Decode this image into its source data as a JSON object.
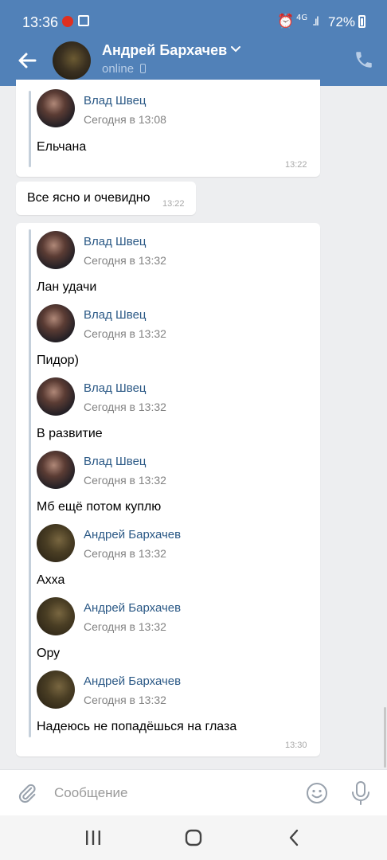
{
  "status_bar": {
    "time": "13:36",
    "network": "4G",
    "battery": "72%"
  },
  "header": {
    "name": "Андрей Бархачев",
    "status": "online"
  },
  "messages": [
    {
      "forwarded": [
        {
          "author": "Влад Швец",
          "date": "Сегодня в 13:08",
          "text": "Ельчана"
        }
      ],
      "time": "13:22"
    },
    {
      "text": "Все ясно и очевидно",
      "time": "13:22"
    },
    {
      "forwarded": [
        {
          "author": "Влад Швец",
          "date": "Сегодня в 13:32",
          "text": "Лан удачи"
        },
        {
          "author": "Влад Швец",
          "date": "Сегодня в 13:32",
          "text": "Пидор)"
        },
        {
          "author": "Влад Швец",
          "date": "Сегодня в 13:32",
          "text": "В развитие"
        },
        {
          "author": "Влад Швец",
          "date": "Сегодня в 13:32",
          "text": "Мб ещё потом куплю"
        },
        {
          "author": "Андрей Бархачев",
          "date": "Сегодня в 13:32",
          "text": "Ахха"
        },
        {
          "author": "Андрей Бархачев",
          "date": "Сегодня в 13:32",
          "text": "Ору"
        },
        {
          "author": "Андрей Бархачев",
          "date": "Сегодня в 13:32",
          "text": "Надеюсь не попадёшься на глаза"
        }
      ],
      "time": "13:30"
    }
  ],
  "composer": {
    "placeholder": "Сообщение"
  },
  "colors": {
    "header": "#5181b8",
    "link": "#2a5885",
    "background": "#edeef0"
  }
}
